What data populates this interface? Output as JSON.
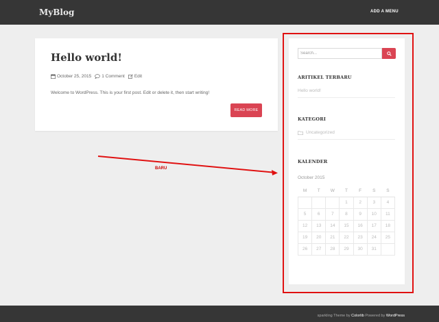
{
  "header": {
    "brand": "MyBlog",
    "menu_label": "ADD A MENU"
  },
  "post": {
    "title": "Hello world!",
    "date": "October 25, 2015",
    "comments": "1 Comment",
    "edit": "Edit",
    "excerpt": "Welcome to WordPress. This is your first post. Edit or delete it, then start writing!",
    "read_more": "READ MORE"
  },
  "sidebar": {
    "search_placeholder": "Search...",
    "recent_title": "ARITIKEL TERBARU",
    "recent_posts": [
      "Hello world!"
    ],
    "categories_title": "KATEGORI",
    "categories": [
      "Uncategorized"
    ],
    "calendar_title": "KALENDER",
    "calendar": {
      "caption": "October 2015",
      "weekdays": [
        "M",
        "T",
        "W",
        "T",
        "F",
        "S",
        "S"
      ],
      "weeks": [
        [
          "",
          "",
          "",
          "1",
          "2",
          "3",
          "4"
        ],
        [
          "5",
          "6",
          "7",
          "8",
          "9",
          "10",
          "11"
        ],
        [
          "12",
          "13",
          "14",
          "15",
          "16",
          "17",
          "18"
        ],
        [
          "19",
          "20",
          "21",
          "22",
          "23",
          "24",
          "25"
        ],
        [
          "26",
          "27",
          "28",
          "29",
          "30",
          "31",
          ""
        ]
      ]
    }
  },
  "annotation": {
    "label": "BARU",
    "color": "#e01010"
  },
  "footer": {
    "theme": "sparkling",
    "theme_by": "Theme by",
    "author": "Colorlib",
    "powered_by": "Powered by",
    "platform": "WordPress"
  },
  "colors": {
    "accent": "#da4453",
    "topbar": "#363636",
    "background": "#eeeeee"
  }
}
